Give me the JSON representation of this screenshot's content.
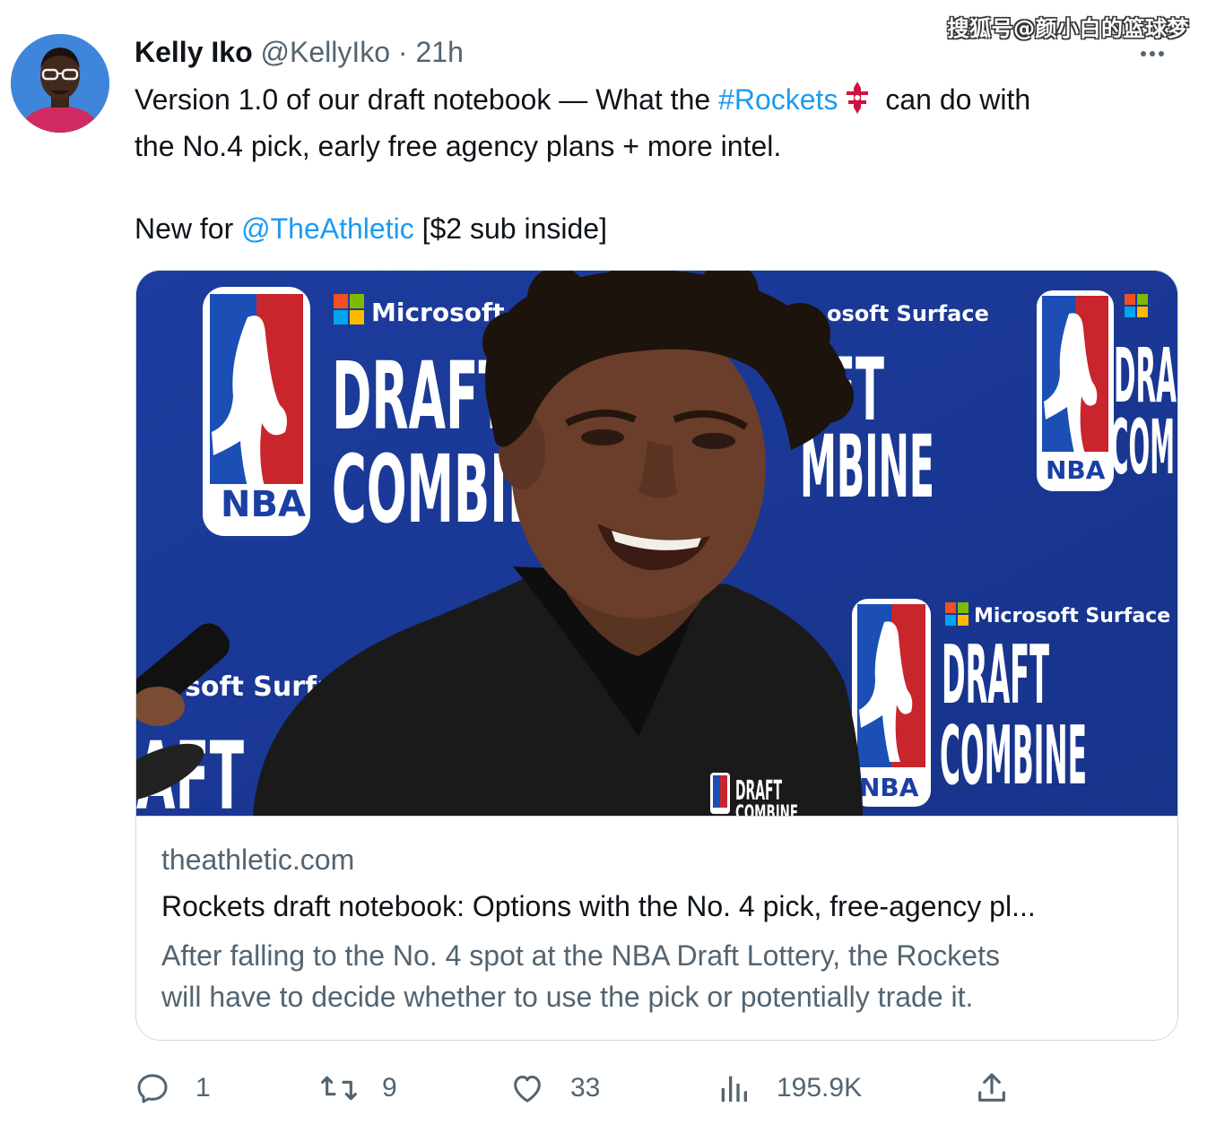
{
  "watermark": "搜狐号@颜小白的篮球梦",
  "tweet": {
    "author_name": "Kelly Iko",
    "author_handle": "@KellyIko",
    "separator": "·",
    "time": "21h",
    "text_line1_before": "Version 1.0 of our draft notebook — What the ",
    "hashtag": "#Rockets",
    "text_line1_after": " can do with",
    "text_line2": "the No.4 pick, early free agency plans + more intel.",
    "text_line3_before": "New for ",
    "mention": "@TheAthletic",
    "text_line3_after": " [$2 sub inside]"
  },
  "card": {
    "image_signs": {
      "brand": "Microsoft S",
      "brand2": "osoft Surface",
      "brand3": "Microsoft Surface",
      "brand4": "soft Surface",
      "draft": "DRAFT",
      "combine": "COMBIN",
      "draft2": "FT",
      "combine2": "MBINE",
      "draft3": "DRAFT",
      "combine3": "COMBINE",
      "draft_left": "AFT",
      "draft4": "DRA",
      "combine4": "COM",
      "nba": "NBA",
      "nba2": "NBA",
      "nba3": "NBA",
      "shirt_draft": "DRAFT",
      "shirt_combine": "COMBINE"
    },
    "domain": "theathletic.com",
    "title": "Rockets draft notebook: Options with the No. 4 pick, free-agency pl...",
    "desc_line1": "After falling to the No. 4 spot at the NBA Draft Lottery, the Rockets",
    "desc_line2": "will have to decide whether to use the pick or potentially trade it."
  },
  "actions": {
    "replies": "1",
    "retweets": "9",
    "likes": "33",
    "views": "195.9K"
  },
  "colors": {
    "link": "#1d9bf0",
    "backdrop_blue": "#1b3fa3",
    "nba_red": "#c9252c",
    "rockets_red": "#ce1141"
  },
  "icons": [
    "reply-icon",
    "retweet-icon",
    "like-icon",
    "views-icon",
    "share-icon",
    "more-icon",
    "rockets-logo-icon"
  ]
}
